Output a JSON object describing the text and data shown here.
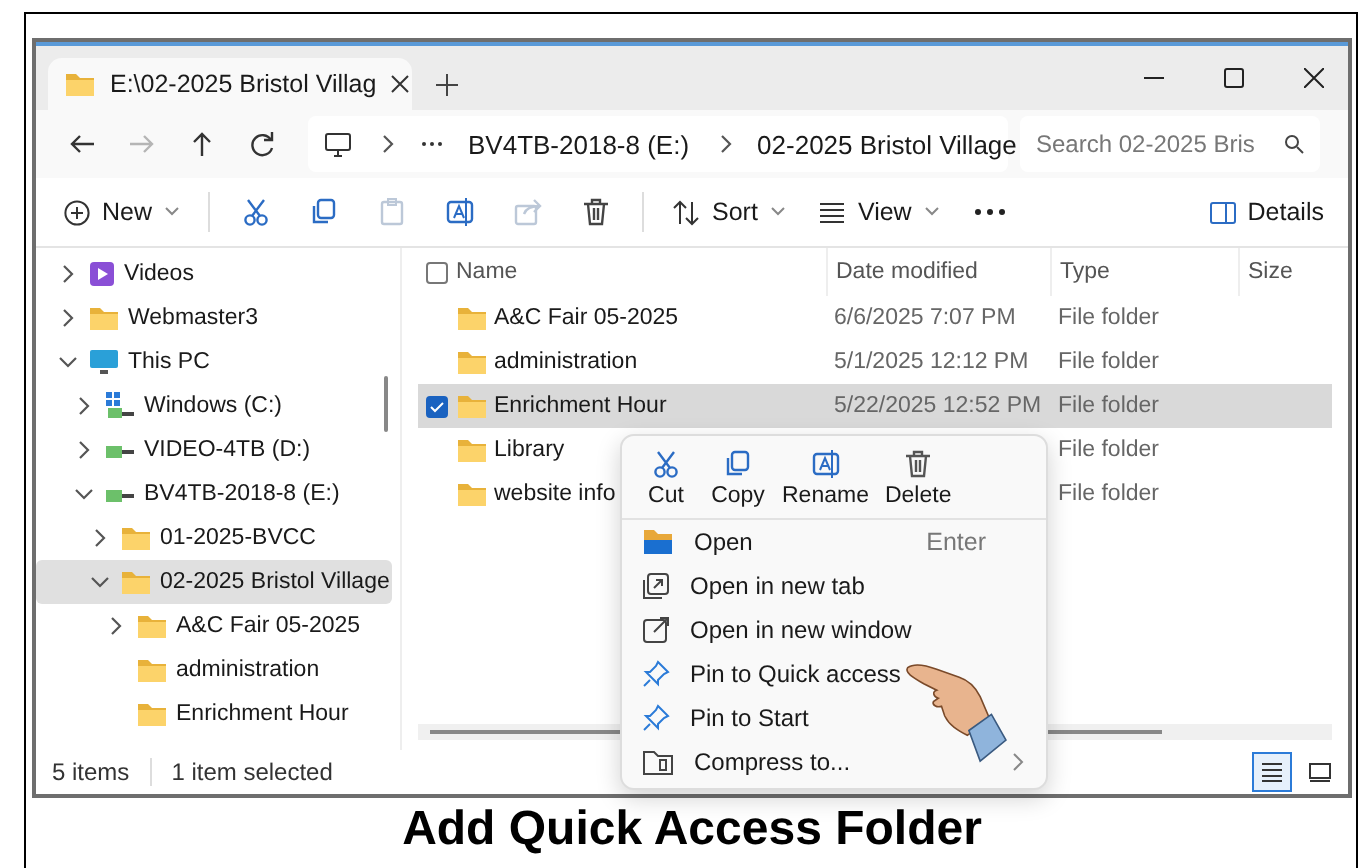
{
  "window": {
    "tab_title": "E:\\02-2025 Bristol Villag",
    "nav_buttons": [
      {
        "kind": "back",
        "disabled": false
      },
      {
        "kind": "forward",
        "disabled": true
      },
      {
        "kind": "up",
        "disabled": false
      },
      {
        "kind": "refresh",
        "disabled": false
      }
    ],
    "breadcrumbs": [
      "BV4TB-2018-8 (E:)",
      "02-2025 Bristol Village"
    ],
    "search": {
      "placeholder": "Search 02-2025 Bris"
    }
  },
  "toolbar": {
    "new": "New",
    "tools": [
      {
        "kind": "cut",
        "disabled": false
      },
      {
        "kind": "copy",
        "disabled": false
      },
      {
        "kind": "paste",
        "disabled": true
      },
      {
        "kind": "rename",
        "disabled": false
      },
      {
        "kind": "share",
        "disabled": true
      },
      {
        "kind": "delete",
        "disabled": false
      }
    ],
    "sort": "Sort",
    "view": "View",
    "details": "Details"
  },
  "sidebar": {
    "items": [
      {
        "label": "Videos",
        "kind": "video",
        "expandable": true,
        "expanded": false,
        "selected": false
      },
      {
        "label": "Webmaster3",
        "kind": "folder",
        "expandable": true,
        "expanded": false,
        "selected": false
      },
      {
        "label": "This PC",
        "kind": "pc",
        "expandable": true,
        "expanded": true,
        "selected": false,
        "children": [
          {
            "label": "Windows (C:)",
            "kind": "system-drive",
            "expandable": true,
            "expanded": false,
            "selected": false
          },
          {
            "label": "VIDEO-4TB (D:)",
            "kind": "drive",
            "expandable": true,
            "expanded": false,
            "selected": false
          },
          {
            "label": "BV4TB-2018-8 (E:)",
            "kind": "drive",
            "expandable": true,
            "expanded": true,
            "selected": false,
            "children": [
              {
                "label": "01-2025-BVCC",
                "kind": "folder",
                "expandable": true,
                "expanded": false,
                "selected": false
              },
              {
                "label": "02-2025 Bristol Village",
                "kind": "folder",
                "expandable": true,
                "expanded": true,
                "selected": true,
                "children": [
                  {
                    "label": "A&C Fair 05-2025",
                    "kind": "folder",
                    "expandable": true,
                    "expanded": false,
                    "selected": false
                  },
                  {
                    "label": "administration",
                    "kind": "folder",
                    "expandable": false,
                    "expanded": false,
                    "selected": false
                  },
                  {
                    "label": "Enrichment Hour",
                    "kind": "folder",
                    "expandable": false,
                    "expanded": false,
                    "selected": false
                  }
                ]
              }
            ]
          }
        ]
      }
    ]
  },
  "files": {
    "select_all_checked": false,
    "columns": [
      "Name",
      "Date modified",
      "Type",
      "Size"
    ],
    "rows": [
      {
        "name": "A&C Fair 05-2025",
        "date": "6/6/2025 7:07 PM",
        "type": "File folder",
        "selected": false
      },
      {
        "name": "administration",
        "date": "5/1/2025 12:12 PM",
        "type": "File folder",
        "selected": false
      },
      {
        "name": "Enrichment Hour",
        "date": "5/22/2025 12:52 PM",
        "type": "File folder",
        "selected": true
      },
      {
        "name": "Library",
        "type": "File folder",
        "selected": false
      },
      {
        "name": "website info",
        "type": "File folder",
        "selected": false
      }
    ]
  },
  "context_menu": {
    "actions": [
      {
        "label": "Cut",
        "kind": "cut"
      },
      {
        "label": "Copy",
        "kind": "copy"
      },
      {
        "label": "Rename",
        "kind": "rename"
      },
      {
        "label": "Delete",
        "kind": "delete"
      }
    ],
    "items": [
      {
        "label": "Open",
        "kind": "open",
        "shortcut": "Enter",
        "submenu": false
      },
      {
        "label": "Open in new tab",
        "kind": "new-tab",
        "submenu": false
      },
      {
        "label": "Open in new window",
        "kind": "new-window",
        "submenu": false
      },
      {
        "label": "Pin to Quick access",
        "kind": "pin",
        "submenu": false
      },
      {
        "label": "Pin to Start",
        "kind": "pin",
        "submenu": false
      },
      {
        "label": "Compress to...",
        "kind": "compress",
        "submenu": true
      }
    ]
  },
  "status_bar": {
    "count": "5 items",
    "selection": "1 item selected",
    "views": [
      {
        "kind": "details",
        "selected": true
      },
      {
        "kind": "tiles",
        "selected": false
      }
    ]
  },
  "caption": "Add Quick Access Folder"
}
